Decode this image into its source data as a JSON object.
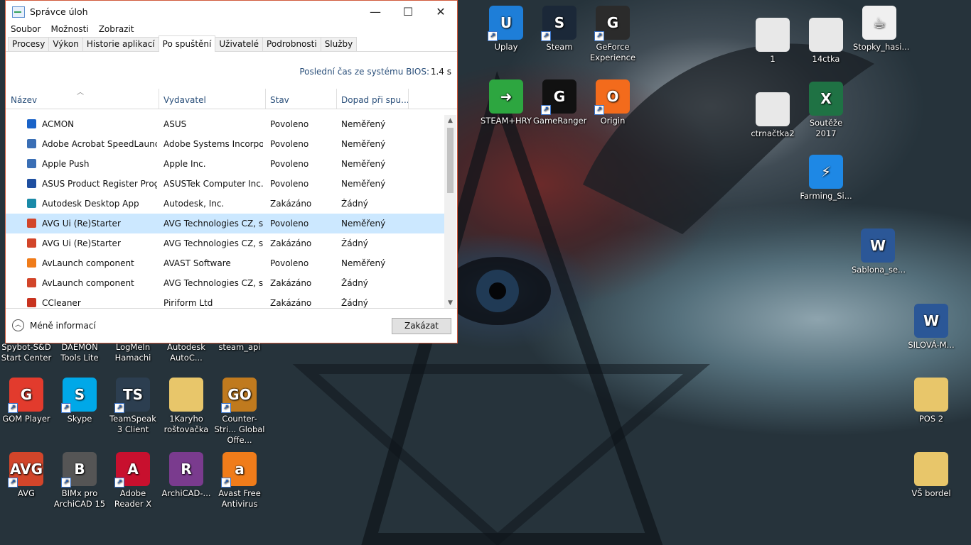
{
  "window": {
    "title": "Správce úloh",
    "controls": {
      "minimize": "—",
      "maximize": "☐",
      "close": "✕"
    },
    "menu": [
      "Soubor",
      "Možnosti",
      "Zobrazit"
    ],
    "tabs": [
      "Procesy",
      "Výkon",
      "Historie aplikací",
      "Po spuštění",
      "Uživatelé",
      "Podrobnosti",
      "Služby"
    ],
    "active_tab": "Po spuštění",
    "bios_label": "Poslední čas ze systému BIOS:",
    "bios_value": "1.4 s",
    "columns": [
      "Název",
      "Vydavatel",
      "Stav",
      "Dopad při spu..."
    ],
    "rows": [
      {
        "name": "ACMON",
        "publisher": "ASUS",
        "status": "Povoleno",
        "impact": "Neměřený",
        "icon": "acmon-icon",
        "color": "#1a63c8"
      },
      {
        "name": "Adobe Acrobat SpeedLaunc...",
        "publisher": "Adobe Systems Incorpor...",
        "status": "Povoleno",
        "impact": "Neměřený",
        "icon": "window-app-icon",
        "color": "#3a6fb5"
      },
      {
        "name": "Apple Push",
        "publisher": "Apple Inc.",
        "status": "Povoleno",
        "impact": "Neměřený",
        "icon": "window-app-icon",
        "color": "#3a6fb5"
      },
      {
        "name": "ASUS Product Register Progr...",
        "publisher": "ASUSTek Computer Inc.",
        "status": "Povoleno",
        "impact": "Neměřený",
        "icon": "asus-icon",
        "color": "#1e4fa0"
      },
      {
        "name": "Autodesk Desktop App",
        "publisher": "Autodesk, Inc.",
        "status": "Zakázáno",
        "impact": "Žádný",
        "icon": "autodesk-icon",
        "color": "#1a8aa8"
      },
      {
        "name": "AVG Ui (Re)Starter",
        "publisher": "AVG Technologies CZ, s....",
        "status": "Povoleno",
        "impact": "Neměřený",
        "icon": "avg-icon",
        "color": "#d2452a",
        "selected": true
      },
      {
        "name": "AVG Ui (Re)Starter",
        "publisher": "AVG Technologies CZ, s....",
        "status": "Zakázáno",
        "impact": "Žádný",
        "icon": "avg-icon",
        "color": "#d2452a"
      },
      {
        "name": "AvLaunch component",
        "publisher": "AVAST Software",
        "status": "Povoleno",
        "impact": "Neměřený",
        "icon": "avast-icon",
        "color": "#f07c1a"
      },
      {
        "name": "AvLaunch component",
        "publisher": "AVG Technologies CZ, s....",
        "status": "Zakázáno",
        "impact": "Žádný",
        "icon": "avg-icon",
        "color": "#d2452a"
      },
      {
        "name": "CCleaner",
        "publisher": "Piriform Ltd",
        "status": "Zakázáno",
        "impact": "Žádný",
        "icon": "ccleaner-icon",
        "color": "#c8331f"
      }
    ],
    "fewer_details": "Méně informací",
    "disable_button": "Zakázat"
  },
  "desktop_icons": [
    {
      "label": "Uplay",
      "icon": "uplay-icon",
      "color": "#1e7ed8",
      "glyph": "U",
      "shortcut": true
    },
    {
      "label": "Steam",
      "icon": "steam-icon",
      "color": "#1b2838",
      "glyph": "S",
      "shortcut": true
    },
    {
      "label": "GeForce Experience",
      "icon": "geforce-icon",
      "color": "#2b2b2b",
      "glyph": "G",
      "shortcut": true
    },
    {
      "label": "1",
      "icon": "file-thumb-icon",
      "color": "#e8e8e8",
      "glyph": "",
      "shortcut": false
    },
    {
      "label": "14ctka",
      "icon": "file-thumb-icon",
      "color": "#e8e8e8",
      "glyph": "",
      "shortcut": false
    },
    {
      "label": "Stopky_hasi...",
      "icon": "java-icon",
      "color": "#f0f0f0",
      "glyph": "☕",
      "shortcut": false
    },
    {
      "label": "STEAM+HRY",
      "icon": "arrow-icon",
      "color": "#2da640",
      "glyph": "➜",
      "shortcut": false
    },
    {
      "label": "GameRanger",
      "icon": "gameranger-icon",
      "color": "#111",
      "glyph": "G",
      "shortcut": true
    },
    {
      "label": "Origin",
      "icon": "origin-icon",
      "color": "#f36b1c",
      "glyph": "O",
      "shortcut": true
    },
    {
      "label": "ctrnačtka2",
      "icon": "file-thumb-icon",
      "color": "#e8e8e8",
      "glyph": "",
      "shortcut": false
    },
    {
      "label": "Soutěže 2017",
      "icon": "excel-icon",
      "color": "#1f7244",
      "glyph": "X",
      "shortcut": false
    },
    {
      "label": "Farming_Si...",
      "icon": "farming-icon",
      "color": "#1e88e5",
      "glyph": "⚡",
      "shortcut": false
    },
    {
      "label": "Sablona_se...",
      "icon": "word-icon",
      "color": "#2b5797",
      "glyph": "W",
      "shortcut": false
    },
    {
      "label": "SILOVÁ-M...",
      "icon": "word-icon",
      "color": "#2b5797",
      "glyph": "W",
      "shortcut": false
    },
    {
      "label": "Spybot-S&D Start Center",
      "icon": "spybot-icon",
      "color": "#444",
      "glyph": "",
      "shortcut": false
    },
    {
      "label": "DAEMON Tools Lite",
      "icon": "daemon-icon",
      "color": "#444",
      "glyph": "",
      "shortcut": false
    },
    {
      "label": "LogMeIn Hamachi",
      "icon": "hamachi-icon",
      "color": "#444",
      "glyph": "",
      "shortcut": false
    },
    {
      "label": "Autodesk AutoC...",
      "icon": "autocad-icon",
      "color": "#444",
      "glyph": "",
      "shortcut": false
    },
    {
      "label": "steam_api",
      "icon": "file-icon",
      "color": "#444",
      "glyph": "",
      "shortcut": false
    },
    {
      "label": "GOM Player",
      "icon": "gom-icon",
      "color": "#e23b2d",
      "glyph": "G",
      "shortcut": true
    },
    {
      "label": "Skype",
      "icon": "skype-icon",
      "color": "#00a8e8",
      "glyph": "S",
      "shortcut": true
    },
    {
      "label": "TeamSpeak 3 Client",
      "icon": "teamspeak-icon",
      "color": "#2c3e50",
      "glyph": "TS",
      "shortcut": true
    },
    {
      "label": "1Karyho roštovačka",
      "icon": "folder-icon",
      "color": "#e8c66a",
      "glyph": "",
      "shortcut": false
    },
    {
      "label": "Counter-Stri... Global Offe...",
      "icon": "csgo-icon",
      "color": "#c07a1e",
      "glyph": "GO",
      "shortcut": true
    },
    {
      "label": "POS 2",
      "icon": "folder-icon",
      "color": "#e8c66a",
      "glyph": "",
      "shortcut": false
    },
    {
      "label": "AVG",
      "icon": "avg-icon",
      "color": "#d2452a",
      "glyph": "AVG",
      "shortcut": true
    },
    {
      "label": "BIMx pro ArchiCAD 15",
      "icon": "bimx-icon",
      "color": "#555",
      "glyph": "B",
      "shortcut": true
    },
    {
      "label": "Adobe Reader X",
      "icon": "adobe-reader-icon",
      "color": "#c8102e",
      "glyph": "A",
      "shortcut": true
    },
    {
      "label": "ArchiCAD-...",
      "icon": "winrar-icon",
      "color": "#7a3b8e",
      "glyph": "R",
      "shortcut": false
    },
    {
      "label": "Avast Free Antivirus",
      "icon": "avast-icon",
      "color": "#f07c1a",
      "glyph": "a",
      "shortcut": true
    },
    {
      "label": "VŠ bordel",
      "icon": "folder-icon",
      "color": "#e8c66a",
      "glyph": "",
      "shortcut": false
    }
  ]
}
